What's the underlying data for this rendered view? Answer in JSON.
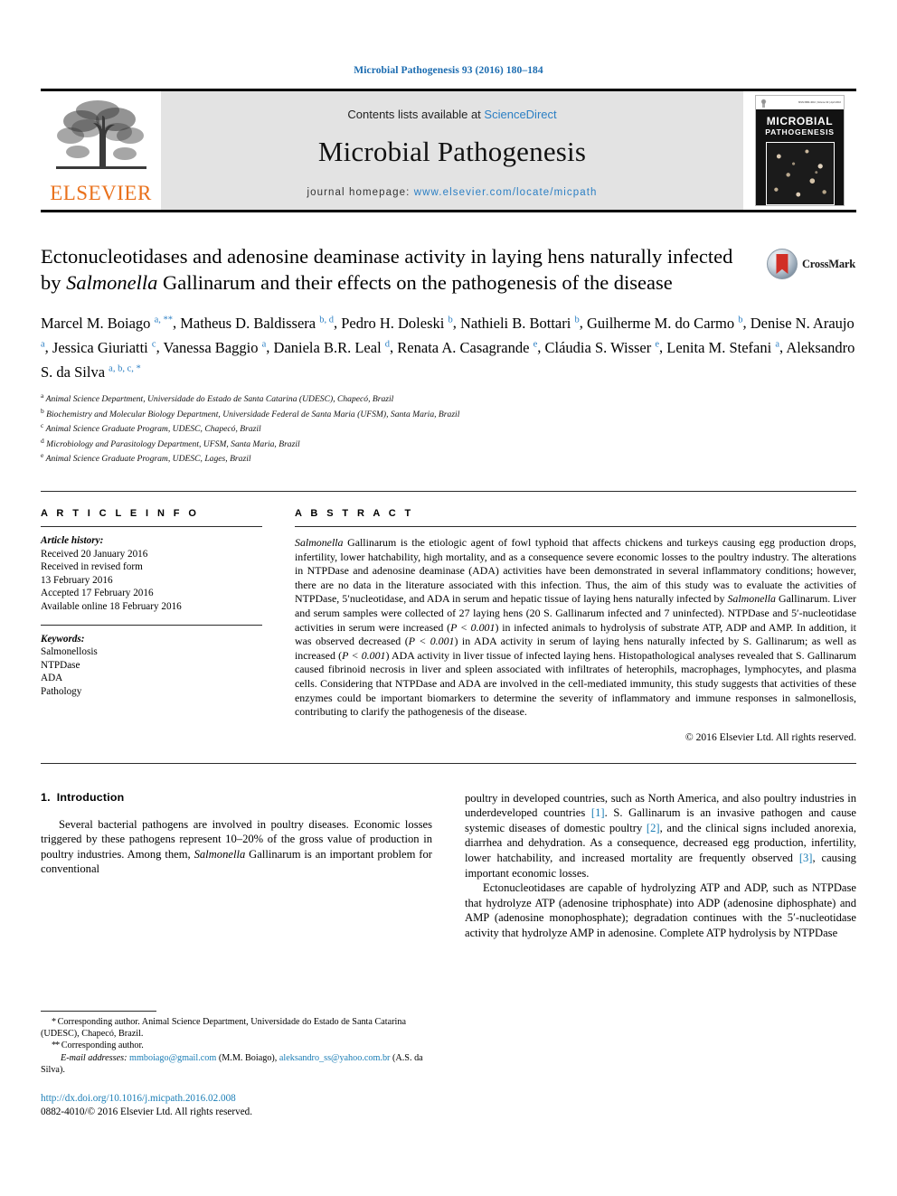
{
  "running_head": "Microbial Pathogenesis 93 (2016) 180–184",
  "masthead": {
    "contents_prefix": "Contents lists available at",
    "sciencedirect": "ScienceDirect",
    "journal_name": "Microbial Pathogenesis",
    "homepage_prefix": "journal homepage:",
    "homepage_url": "www.elsevier.com/locate/micpath",
    "publisher_logo_text": "ELSEVIER",
    "cover": {
      "line1": "MICROBIAL",
      "line2": "PATHOGENESIS",
      "meta": "ISSN 0882-4010 | Volume 93 | April 2016"
    },
    "link_color": "#2b7fc4"
  },
  "article": {
    "title_part1": "Ectonucleotidases and adenosine deaminase activity in laying hens naturally infected by ",
    "title_italic": "Salmonella",
    "title_part2": " Gallinarum and their effects on the pathogenesis of the disease",
    "crossmark_label": "CrossMark",
    "authors": [
      {
        "name": "Marcel M. Boiago",
        "marks": "a, **"
      },
      {
        "name": "Matheus D. Baldissera",
        "marks": "b, d"
      },
      {
        "name": "Pedro H. Doleski",
        "marks": "b"
      },
      {
        "name": "Nathieli B. Bottari",
        "marks": "b"
      },
      {
        "name": "Guilherme M. do Carmo",
        "marks": "b"
      },
      {
        "name": "Denise N. Araujo",
        "marks": "a"
      },
      {
        "name": "Jessica Giuriatti",
        "marks": "c"
      },
      {
        "name": "Vanessa Baggio",
        "marks": "a"
      },
      {
        "name": "Daniela B.R. Leal",
        "marks": "d"
      },
      {
        "name": "Renata A. Casagrande",
        "marks": "e"
      },
      {
        "name": "Cláudia S. Wisser",
        "marks": "e"
      },
      {
        "name": "Lenita M. Stefani",
        "marks": "a"
      },
      {
        "name": "Aleksandro S. da Silva",
        "marks": "a, b, c, *"
      }
    ],
    "affiliations": [
      {
        "mark": "a",
        "text": "Animal Science Department, Universidade do Estado de Santa Catarina (UDESC), Chapecó, Brazil"
      },
      {
        "mark": "b",
        "text": "Biochemistry and Molecular Biology Department, Universidade Federal de Santa Maria (UFSM), Santa Maria, Brazil"
      },
      {
        "mark": "c",
        "text": "Animal Science Graduate Program, UDESC, Chapecó, Brazil"
      },
      {
        "mark": "d",
        "text": "Microbiology and Parasitology Department, UFSM, Santa Maria, Brazil"
      },
      {
        "mark": "e",
        "text": "Animal Science Graduate Program, UDESC, Lages, Brazil"
      }
    ]
  },
  "article_info": {
    "heading": "A R T I C L E   I N F O",
    "history_label": "Article history:",
    "history": [
      "Received 20 January 2016",
      "Received in revised form",
      "13 February 2016",
      "Accepted 17 February 2016",
      "Available online 18 February 2016"
    ],
    "keywords_label": "Keywords:",
    "keywords": [
      "Salmonellosis",
      "NTPDase",
      "ADA",
      "Pathology"
    ]
  },
  "abstract": {
    "heading": "A B S T R A C T",
    "lead_italic": "Salmonella",
    "text": " Gallinarum is the etiologic agent of fowl typhoid that affects chickens and turkeys causing egg production drops, infertility, lower hatchability, high mortality, and as a consequence severe economic losses to the poultry industry. The alterations in NTPDase and adenosine deaminase (ADA) activities have been demonstrated in several inflammatory conditions; however, there are no data in the literature associated with this infection. Thus, the aim of this study was to evaluate the activities of NTPDase, 5′nucleotidase, and ADA in serum and hepatic tissue of laying hens naturally infected by ",
    "italic_2": "Salmonella",
    "text_2": " Gallinarum. Liver and serum samples were collected of 27 laying hens (20 S. Gallinarum infected and 7 uninfected). NTPDase and 5′-nucleotidase activities in serum were increased (",
    "stat_1": "P < 0.001",
    "text_3": ") in infected animals to hydrolysis of substrate ATP, ADP and AMP. In addition, it was observed decreased (",
    "stat_2": "P < 0.001",
    "text_4": ") in ADA activity in serum of laying hens naturally infected by S. Gallinarum; as well as increased (",
    "stat_3": "P < 0.001",
    "text_5": ") ADA activity in liver tissue of infected laying hens. Histopathological analyses revealed that S. Gallinarum caused fibrinoid necrosis in liver and spleen associated with infiltrates of heterophils, macrophages, lymphocytes, and plasma cells. Considering that NTPDase and ADA are involved in the cell-mediated immunity, this study suggests that activities of these enzymes could be important biomarkers to determine the severity of inflammatory and immune responses in salmonellosis, contributing to clarify the pathogenesis of the disease.",
    "copyright": "© 2016 Elsevier Ltd. All rights reserved."
  },
  "introduction": {
    "number": "1.",
    "title": "Introduction",
    "left_para_1a": "Several bacterial pathogens are involved in poultry diseases. Economic losses triggered by these pathogens represent 10–20% of the gross value of production in poultry industries. Among them, ",
    "left_para_1_italic": "Salmonella",
    "left_para_1b": " Gallinarum is an important problem for conventional",
    "right_para_1a": "poultry in developed countries, such as North America, and also poultry industries in underdeveloped countries ",
    "ref_1": "[1]",
    "right_para_1b": ". S. Gallinarum is an invasive pathogen and cause systemic diseases of domestic poultry ",
    "ref_2": "[2]",
    "right_para_1c": ", and the clinical signs included anorexia, diarrhea and dehydration. As a consequence, decreased egg production, infertility, lower hatchability, and increased mortality are frequently observed ",
    "ref_3": "[3]",
    "right_para_1d": ", causing important economic losses.",
    "right_para_2": "Ectonucleotidases are capable of hydrolyzing ATP and ADP, such as NTPDase that hydrolyze ATP (adenosine triphosphate) into ADP (adenosine diphosphate) and AMP (adenosine monophosphate); degradation continues with the 5′-nucleotidase activity that hydrolyze AMP in adenosine. Complete ATP hydrolysis by NTPDase"
  },
  "footnotes": {
    "star_mark": "*",
    "star_text": " Corresponding author. Animal Science Department, Universidade do Estado de Santa Catarina (UDESC), Chapecó, Brazil.",
    "dstar_mark": "**",
    "dstar_text": " Corresponding author.",
    "email_label": "E-mail addresses:",
    "email_1": "mmboiago@gmail.com",
    "email_1_owner": "(M.M. Boiago),",
    "email_2": "aleksandro_ss@yahoo.com.br",
    "email_2_owner": "(A.S. da Silva).",
    "doi": "http://dx.doi.org/10.1016/j.micpath.2016.02.008",
    "issn_line": "0882-4010/© 2016 Elsevier Ltd. All rights reserved."
  }
}
